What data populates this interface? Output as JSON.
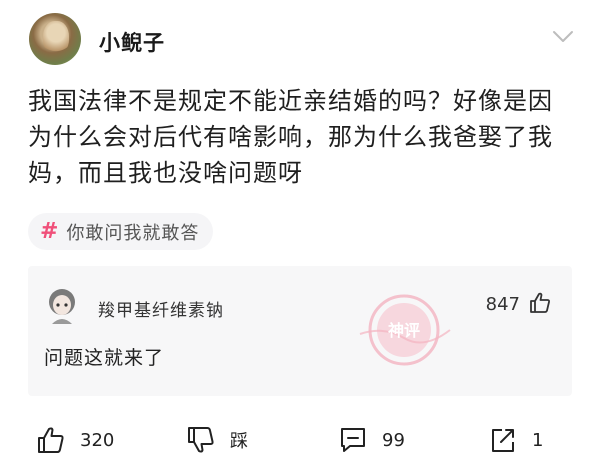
{
  "post": {
    "username": "小鲵子",
    "text": "我国法律不是规定不能近亲结婚的吗？好像是因为什么会对后代有啥影响，那为什么我爸娶了我妈，而且我也没啥问题呀",
    "topic": "你敢问我就敢答"
  },
  "top_comment": {
    "username": "羧甲基纤维素钠",
    "text": "问题这就来了",
    "likes": "847",
    "stamp_text": "神评"
  },
  "actions": {
    "like_count": "320",
    "dislike_label": "踩",
    "comment_count": "99",
    "share_count": "1"
  },
  "colors": {
    "accent": "#f0507a",
    "stamp": "#f3a8b8"
  }
}
